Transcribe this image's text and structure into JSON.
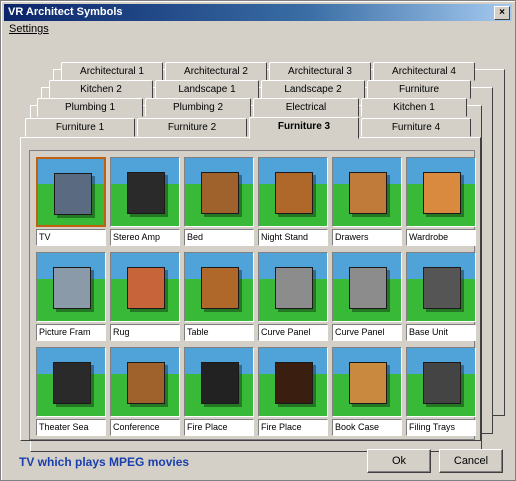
{
  "window": {
    "title": "VR Architect Symbols",
    "close_glyph": "×"
  },
  "menu": {
    "settings": "Settings"
  },
  "tab_rows": [
    [
      "Architectural 1",
      "Architectural 2",
      "Architectural 3",
      "Architectural 4"
    ],
    [
      "Kitchen 2",
      "Landscape 1",
      "Landscape 2",
      "Furniture"
    ],
    [
      "Plumbing 1",
      "Plumbing 2",
      "Electrical",
      "Kitchen 1"
    ],
    [
      "Furniture 1",
      "Furniture 2",
      "Furniture 3",
      "Furniture 4"
    ]
  ],
  "active_tab": "Furniture 3",
  "items": [
    {
      "label": "TV",
      "icon": "tv-icon",
      "color": "#5a6a80"
    },
    {
      "label": "Stereo Amp",
      "icon": "stereo-amp-icon",
      "color": "#2a2a2a"
    },
    {
      "label": "Bed",
      "icon": "bed-icon",
      "color": "#a0622d"
    },
    {
      "label": "Night Stand",
      "icon": "night-stand-icon",
      "color": "#b0682a"
    },
    {
      "label": "Drawers",
      "icon": "drawers-icon",
      "color": "#c07a3a"
    },
    {
      "label": "Wardrobe",
      "icon": "wardrobe-icon",
      "color": "#d98a3f"
    },
    {
      "label": "Picture Fram",
      "icon": "picture-frame-icon",
      "color": "#8a9aa8"
    },
    {
      "label": "Rug",
      "icon": "rug-icon",
      "color": "#c8643a"
    },
    {
      "label": "Table",
      "icon": "table-icon",
      "color": "#b0682a"
    },
    {
      "label": "Curve Panel",
      "icon": "curve-panel-icon",
      "color": "#8c8c8c"
    },
    {
      "label": "Curve Panel",
      "icon": "curve-panel-icon",
      "color": "#8c8c8c"
    },
    {
      "label": "Base Unit",
      "icon": "base-unit-icon",
      "color": "#555555"
    },
    {
      "label": "Theater Sea",
      "icon": "theater-seat-icon",
      "color": "#2a2a2a"
    },
    {
      "label": "Conference",
      "icon": "conference-table-icon",
      "color": "#a0622d"
    },
    {
      "label": "Fire Place",
      "icon": "fireplace-icon",
      "color": "#222222"
    },
    {
      "label": "Fire Place",
      "icon": "fireplace-icon",
      "color": "#3a1f10"
    },
    {
      "label": "Book Case",
      "icon": "book-case-icon",
      "color": "#c98a40"
    },
    {
      "label": "Filing Trays",
      "icon": "filing-trays-icon",
      "color": "#444444"
    }
  ],
  "status": "TV which plays MPEG movies",
  "buttons": {
    "ok": "Ok",
    "cancel": "Cancel"
  }
}
